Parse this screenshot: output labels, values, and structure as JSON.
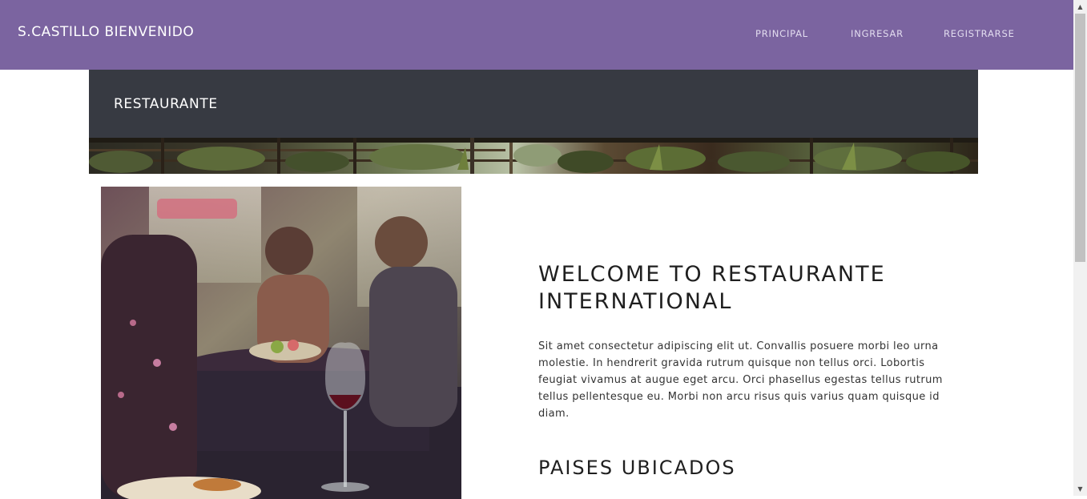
{
  "navbar": {
    "brand": "S.CASTILLO BIENVENIDO",
    "links": [
      {
        "label": "PRINCIPAL"
      },
      {
        "label": "INGRESAR"
      },
      {
        "label": "REGISTRARSE"
      }
    ],
    "background_color": "#7b64a0"
  },
  "header": {
    "title": "RESTAURANTE",
    "background_color": "#373a42"
  },
  "main": {
    "welcome_title": "WELCOME TO RESTAURANTE INTERNATIONAL",
    "intro_text": "Sit amet consectetur adipiscing elit ut. Convallis posuere morbi leo urna molestie. In hendrerit gravida rutrum quisque non tellus orci. Lobortis feugiat vivamus at augue eget arcu. Orci phasellus egestas tellus rutrum tellus pellentesque eu. Morbi non arcu risus quis varius quam quisque id diam.",
    "countries_title": "PAISES UBICADOS"
  },
  "icons": {
    "scroll_up": "scroll-up-arrow-icon",
    "scroll_down": "scroll-down-arrow-icon"
  }
}
